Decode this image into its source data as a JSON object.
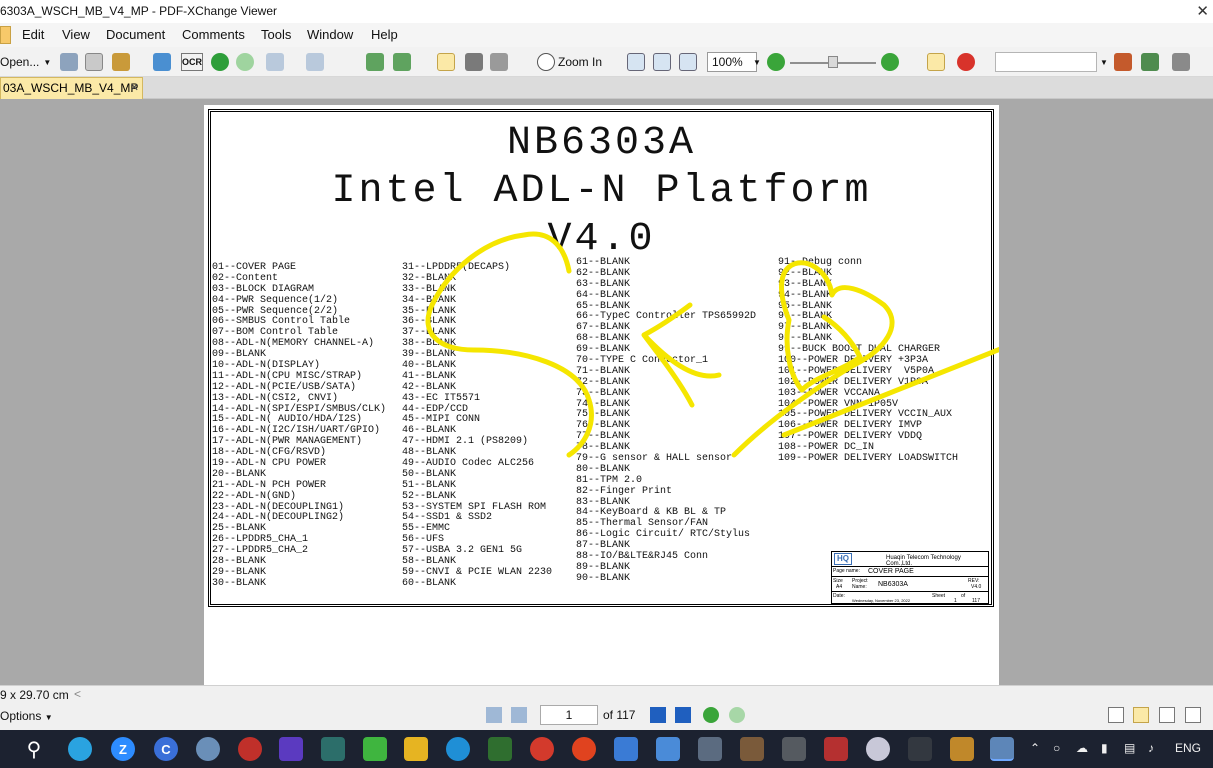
{
  "window": {
    "title": "6303A_WSCH_MB_V4_MP - PDF-XChange Viewer"
  },
  "menu": {
    "items": [
      "Edit",
      "View",
      "Document",
      "Comments",
      "Tools",
      "Window",
      "Help"
    ]
  },
  "toolbar": {
    "open_label": "Open...",
    "ocr_label": "OCR",
    "zoom_in_label": "Zoom In",
    "zoom_value": "100%"
  },
  "tab": {
    "label": "03A_WSCH_MB_V4_MP"
  },
  "document": {
    "title_line1": "NB6303A",
    "title_line2": "Intel ADL-N Platform",
    "title_line3": "V4.0",
    "toc": {
      "col1": [
        "01--COVER PAGE",
        "02--Content",
        "03--BLOCK DIAGRAM",
        "04--PWR Sequence(1/2)",
        "05--PWR Sequence(2/2)",
        "06--SMBUS Control Table",
        "07--BOM Control Table",
        "08--ADL-N(MEMORY CHANNEL-A)",
        "09--BLANK",
        "10--ADL-N(DISPLAY)",
        "11--ADL-N(CPU MISC/STRAP)",
        "12--ADL-N(PCIE/USB/SATA)",
        "13--ADL-N(CSI2, CNVI)",
        "14--ADL-N(SPI/ESPI/SMBUS/CLK)",
        "15--ADL-N( AUDIO/HDA/I2S)",
        "16--ADL-N(I2C/ISH/UART/GPIO)",
        "17--ADL-N(PWR MANAGEMENT)",
        "18--ADL-N(CFG/RSVD)",
        "19--ADL-N CPU POWER",
        "20--BLANK",
        "21--ADL-N PCH POWER",
        "22--ADL-N(GND)",
        "23--ADL-N(DECOUPLING1)",
        "24--ADL-N(DECOUPLING2)",
        "25--BLANK",
        "26--LPDDR5_CHA_1",
        "27--LPDDR5_CHA_2",
        "28--BLANK",
        "29--BLANK",
        "30--BLANK"
      ],
      "col2": [
        "31--LPDDR5(DECAPS)",
        "32--BLANK",
        "33--BLANK",
        "34--BLANK",
        "35--BLANK",
        "36--BLANK",
        "37--BLANK",
        "38--BLANK",
        "39--BLANK",
        "40--BLANK",
        "41--BLANK",
        "42--BLANK",
        "43--EC IT5571",
        "44--EDP/CCD",
        "45--MIPI CONN",
        "46--BLANK",
        "47--HDMI 2.1 (PS8209)",
        "48--BLANK",
        "49--AUDIO Codec ALC256",
        "50--BLANK",
        "51--BLANK",
        "52--BLANK",
        "53--SYSTEM SPI FLASH ROM",
        "54--SSD1 & SSD2",
        "55--EMMC",
        "56--UFS",
        "57--USBA 3.2 GEN1 5G",
        "58--BLANK",
        "59--CNVI & PCIE WLAN 2230",
        "60--BLANK"
      ],
      "col3": [
        "61--BLANK",
        "62--BLANK",
        "63--BLANK",
        "64--BLANK",
        "65--BLANK",
        "66--TypeC Controller TPS65992D",
        "67--BLANK",
        "68--BLANK",
        "69--BLANK",
        "70--TYPE C Connector_1",
        "71--BLANK",
        "72--BLANK",
        "73--BLANK",
        "74--BLANK",
        "75--BLANK",
        "76--BLANK",
        "77--BLANK",
        "78--BLANK",
        "79--G sensor & HALL sensor",
        "80--BLANK",
        "81--TPM 2.0",
        "82--Finger Print",
        "83--BLANK",
        "84--KeyBoard & KB BL & TP",
        "85--Thermal Sensor/FAN",
        "86--Logic Circuit/ RTC/Stylus",
        "87--BLANK",
        "88--IO/B&LTE&RJ45 Conn",
        "89--BLANK",
        "90--BLANK"
      ],
      "col4": [
        "91--Debug conn",
        "92--BLANK",
        "93--BLANK",
        "94--BLANK",
        "95--BLANK",
        "96--BLANK",
        "97--BLANK",
        "98--BLANK",
        "99--BUCK BOOST DUAL CHARGER",
        "100--POWER DELIVERY +3P3A",
        "101--POWER DELIVERY  V5P0A",
        "102--POWER DELIVERY V1P8A",
        "103--POWER VCCANA",
        "104--POWER VNN 1P05V",
        "105--POWER DELIVERY VCCIN_AUX",
        "106--POWER DELIVERY IMVP",
        "107--POWER DELIVERY VDDQ",
        "108--POWER DC_IN",
        "109--POWER DELIVERY LOADSWITCH"
      ]
    },
    "title_block": {
      "logo_text": "HQ",
      "company": "Huaqin Telecom Technology Com.,Ltd.",
      "page_name_label": "Page name:",
      "page_name": "COVER PAGE",
      "size_label": "Size",
      "size_value": "A4",
      "project_label": "Project Name:",
      "project_name": "NB6303A",
      "rev_label": "REV:",
      "rev_value": "V4.0",
      "date_label": "Date:",
      "date_value": "Wednesday, November 23, 2022",
      "sheet_label": "Sheet",
      "sheet_value": "1",
      "of_label": "of",
      "of_value": "117"
    },
    "annotation_color": "#f5e600"
  },
  "statusbar": {
    "dimensions": "9 x 29.70 cm",
    "options_label": "Options",
    "current_page": "1",
    "page_total": "of 117"
  },
  "taskbar": {
    "language": "ENG"
  }
}
